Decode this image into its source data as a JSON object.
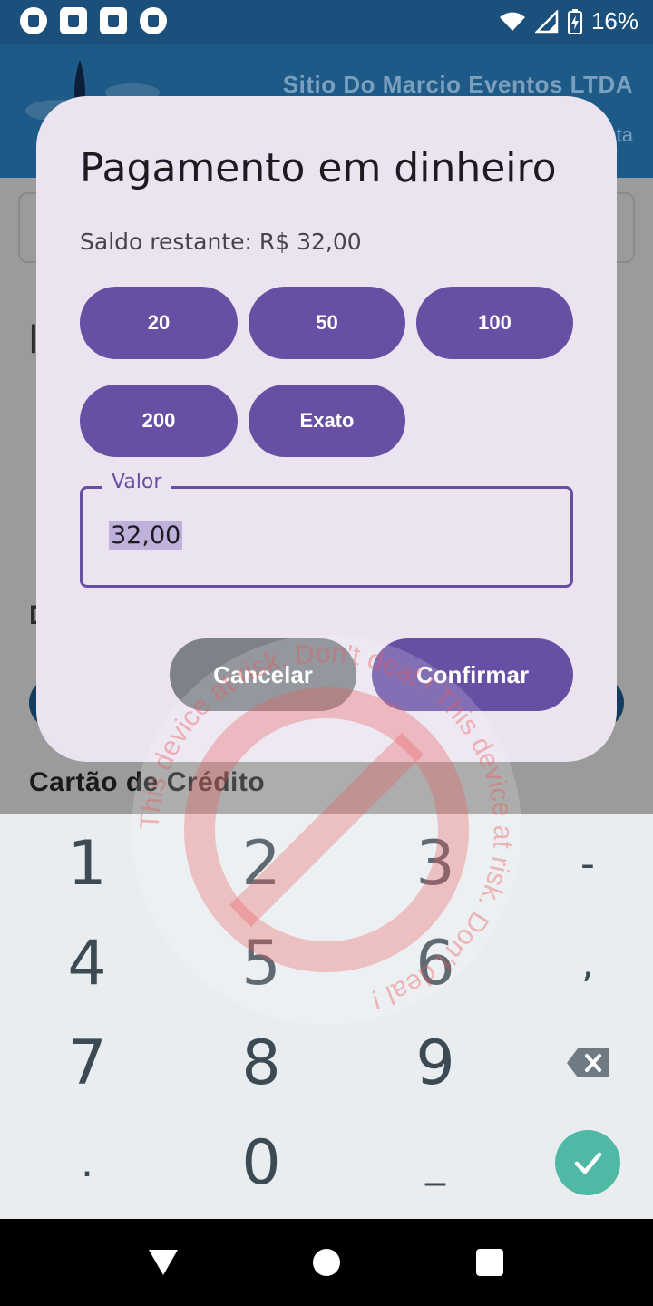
{
  "status_bar": {
    "battery_percent": "16%",
    "left_icons": [
      "app-icon",
      "sync-icon",
      "grid-icon",
      "app-icon"
    ]
  },
  "app": {
    "company_name": "Sitio Do Marcio Eventos LTDA",
    "company_sub": "ta",
    "section_letter": "l",
    "section_letter_2": "D",
    "card_title": "Cartão de Crédito"
  },
  "dialog": {
    "title": "Pagamento em dinheiro",
    "balance": "Saldo restante: R$ 32,00",
    "amount_buttons": [
      "20",
      "50",
      "100",
      "200",
      "Exato"
    ],
    "field_label": "Valor",
    "field_value": "32,00",
    "cancel_label": "Cancelar",
    "confirm_label": "Confirmar"
  },
  "keyboard": {
    "keys": [
      "1",
      "2",
      "3",
      "-",
      "4",
      "5",
      "6",
      ",",
      "7",
      "8",
      "9",
      "backspace-icon",
      ".",
      "0",
      "_",
      "check-icon"
    ]
  },
  "watermark": {
    "text": "This device at risk. Don't deal ! This device at risk. Don't deal !"
  },
  "colors": {
    "primary": "#6750a4",
    "dialog_bg": "#ebe3ef",
    "header": "#1e5a87",
    "done_key": "#4fb9a6"
  }
}
